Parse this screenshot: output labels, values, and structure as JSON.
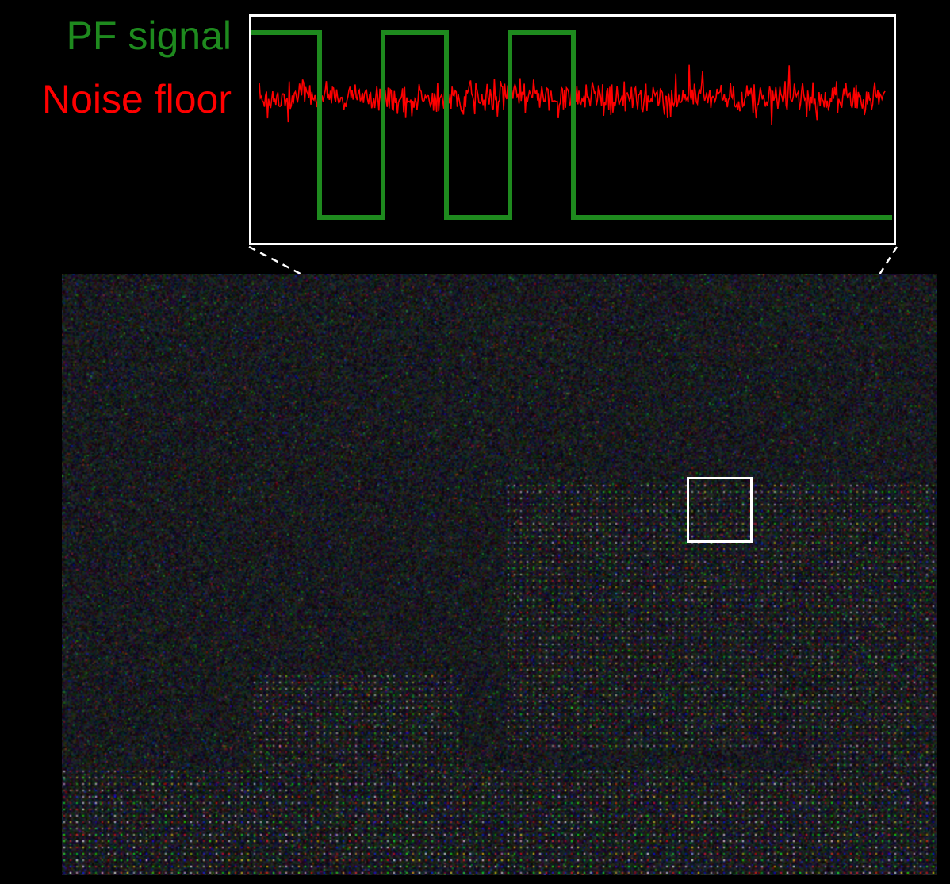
{
  "legend": {
    "signal_label": "PF signal",
    "noise_label": "Noise floor"
  },
  "colors": {
    "background": "#000000",
    "signal": "#1e8a1e",
    "noise": "#ff0000",
    "frame": "#ffffff",
    "connector": "#ffffff"
  },
  "inset_plot": {
    "signal": {
      "type": "square-wave",
      "levels": [
        "high",
        "low"
      ],
      "start_level": "high",
      "pulses": 3,
      "final_level": "low"
    },
    "noise": {
      "type": "random-noise"
    }
  },
  "background_image": {
    "type": "rgb-noise-pattern"
  }
}
